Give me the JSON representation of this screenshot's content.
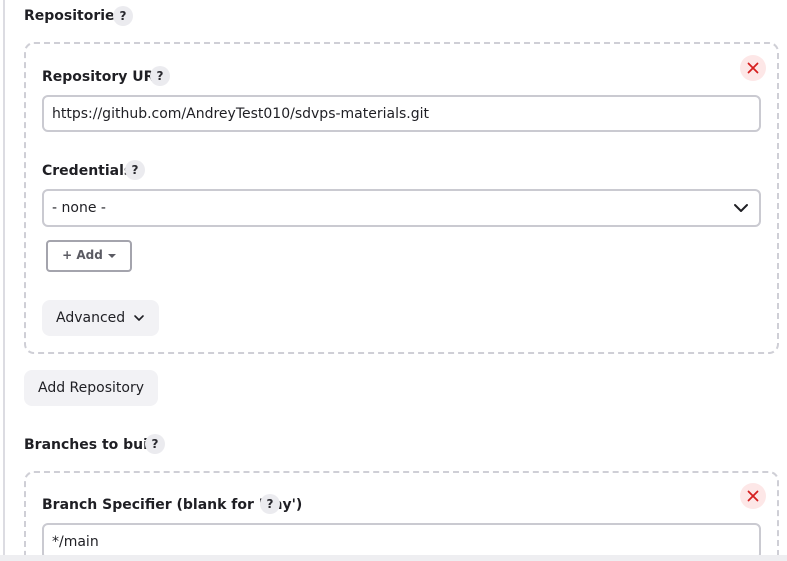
{
  "repositories": {
    "title": "Repositories",
    "help_label": "?",
    "items": [
      {
        "url_label": "Repository URL",
        "url_help": "?",
        "url_value": "https://github.com/AndreyTest010/sdvps-materials.git",
        "credentials_label": "Credentials",
        "credentials_help": "?",
        "credentials_value": "- none -",
        "add_label": "+ Add",
        "advanced_label": "Advanced"
      }
    ],
    "add_repository_label": "Add Repository"
  },
  "branches": {
    "title": "Branches to build",
    "help_label": "?",
    "items": [
      {
        "specifier_label": "Branch Specifier (blank for 'any')",
        "specifier_help": "?",
        "specifier_value": "*/main"
      }
    ]
  },
  "icons": {
    "delete": "close-icon",
    "dropdown": "chevron-down-icon",
    "add_caret": "caret-down-icon"
  },
  "colors": {
    "delete_icon": "#d61f1f",
    "delete_bg": "#fde7e7",
    "input_border": "#cacad1",
    "dashed_border": "#cfcfd6"
  }
}
